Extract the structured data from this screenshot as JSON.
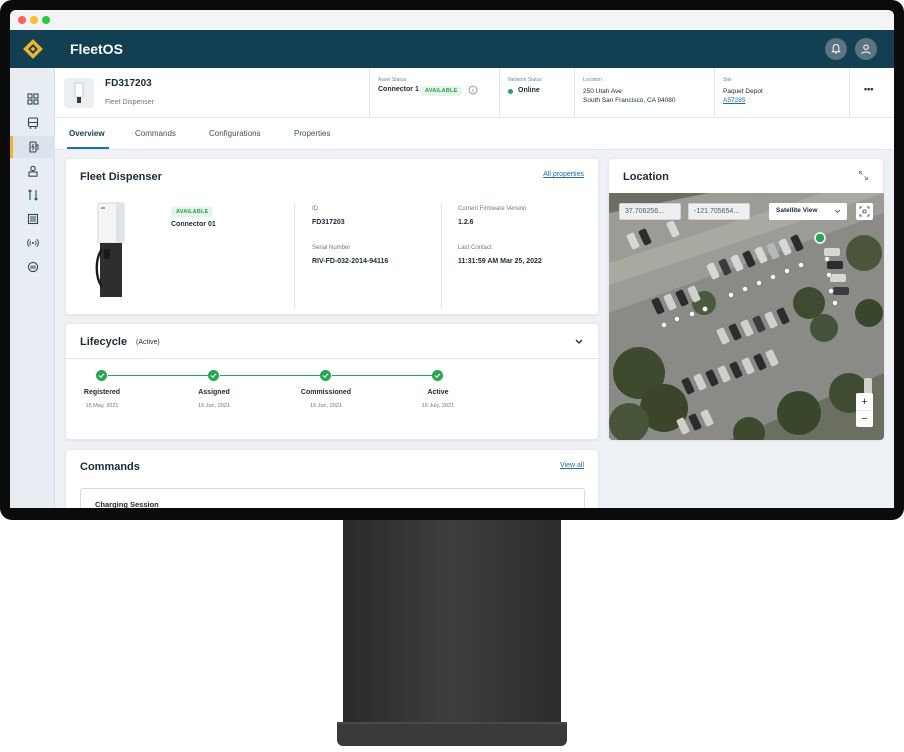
{
  "app": {
    "name": "FleetOS"
  },
  "asset": {
    "id": "FD317203",
    "type": "Fleet Dispenser",
    "status_label": "Asset Status",
    "connector": "Connector 1",
    "status_badge": "AVAILABLE",
    "network_label": "Network Status",
    "network_value": "Online",
    "location_label": "Location",
    "address_line1": "250 Utah Ave",
    "address_line2": "South San Francisco, CA 94080",
    "site_label": "Site",
    "site_name": "Paquet Depot",
    "site_code": "A57285",
    "more": "•••"
  },
  "tabs": [
    {
      "label": "Overview",
      "active": true
    },
    {
      "label": "Commands"
    },
    {
      "label": "Configurations"
    },
    {
      "label": "Properties"
    }
  ],
  "dispenser_card": {
    "title": "Fleet Dispenser",
    "link": "All properties",
    "badge": "AVAILABLE",
    "connector": "Connector 01",
    "fields": [
      {
        "label": "ID",
        "value": "FD317203"
      },
      {
        "label": "Serial Number",
        "value": "RIV-FD-032-2014-94116"
      },
      {
        "label": "Current Firmware Version",
        "value": "1.2.6"
      },
      {
        "label": "Last Contact",
        "value": "11:31:59 AM Mar 25, 2022"
      }
    ]
  },
  "lifecycle": {
    "title": "Lifecycle",
    "state": "(Active)",
    "steps": [
      {
        "name": "Registered",
        "date": "16 May, 2021"
      },
      {
        "name": "Assigned",
        "date": "16 Jun, 2021"
      },
      {
        "name": "Commissioned",
        "date": "16 Jun, 2021"
      },
      {
        "name": "Active",
        "date": "16 July, 2021"
      }
    ]
  },
  "commands": {
    "title": "Commands",
    "link": "View all",
    "first_item": "Charging Session"
  },
  "location_card": {
    "title": "Location",
    "lat": "37.706256...",
    "lng": "-121.705654...",
    "view": "Satellite View",
    "zoom_in": "+",
    "zoom_out": "−"
  },
  "colors": {
    "appbar": "#133f52",
    "accent": "#f0b429",
    "success": "#22a94f",
    "link": "#1d6fa5"
  },
  "icons": [
    "logo-icon",
    "bell-icon",
    "user-icon",
    "dashboard-icon",
    "bus-icon",
    "charger-icon",
    "person-icon",
    "tools-icon",
    "list-icon",
    "signal-icon",
    "support-icon",
    "check-icon",
    "chevron-down-icon",
    "expand-icon",
    "locate-icon"
  ]
}
